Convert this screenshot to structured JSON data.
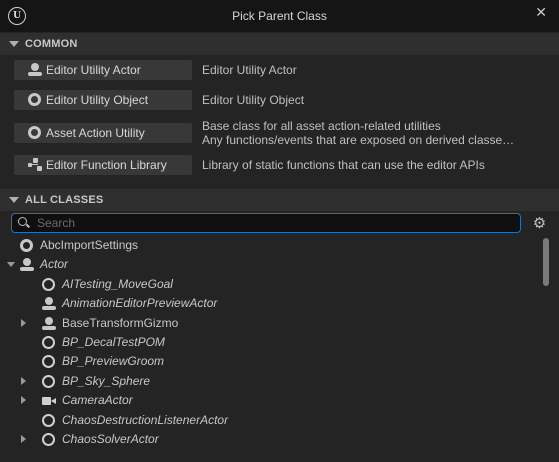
{
  "window": {
    "title": "Pick Parent Class",
    "close_glyph": "✕",
    "logo_letter": "U"
  },
  "common": {
    "header": "COMMON",
    "items": [
      {
        "label": "Editor Utility Actor",
        "icon": "actor-icon",
        "desc": [
          "Editor Utility Actor"
        ]
      },
      {
        "label": "Editor Utility Object",
        "icon": "object-icon",
        "desc": [
          "Editor Utility Object"
        ]
      },
      {
        "label": "Asset Action Utility",
        "icon": "object-icon",
        "desc": [
          "Base class for all asset action-related utilities",
          "Any functions/events that are exposed on derived classe…"
        ]
      },
      {
        "label": "Editor Function Library",
        "icon": "function-library-icon",
        "desc": [
          "Library of static functions that can use the editor APIs"
        ]
      }
    ]
  },
  "all_classes": {
    "header": "ALL CLASSES",
    "search_placeholder": "Search",
    "settings_glyph": "⚙",
    "items": [
      {
        "label": "AbcImportSettings",
        "icon": "object-icon",
        "italic": false,
        "level": 0,
        "expander": "none"
      },
      {
        "label": "Actor",
        "icon": "actor-icon",
        "italic": true,
        "level": 0,
        "expander": "down"
      },
      {
        "label": "AITesting_MoveGoal",
        "icon": "ring-icon",
        "italic": true,
        "level": 1,
        "expander": "none"
      },
      {
        "label": "AnimationEditorPreviewActor",
        "icon": "actor-icon",
        "italic": true,
        "level": 1,
        "expander": "none"
      },
      {
        "label": "BaseTransformGizmo",
        "icon": "actor-icon",
        "italic": false,
        "level": 1,
        "expander": "right"
      },
      {
        "label": "BP_DecalTestPOM",
        "icon": "ring-icon",
        "italic": true,
        "level": 1,
        "expander": "none"
      },
      {
        "label": "BP_PreviewGroom",
        "icon": "ring-icon",
        "italic": true,
        "level": 1,
        "expander": "none"
      },
      {
        "label": "BP_Sky_Sphere",
        "icon": "ring-icon",
        "italic": true,
        "level": 1,
        "expander": "right"
      },
      {
        "label": "CameraActor",
        "icon": "camera-icon",
        "italic": true,
        "level": 1,
        "expander": "right"
      },
      {
        "label": "ChaosDestructionListenerActor",
        "icon": "ring-icon",
        "italic": true,
        "level": 1,
        "expander": "none"
      },
      {
        "label": "ChaosSolverActor",
        "icon": "ring-icon",
        "italic": true,
        "level": 1,
        "expander": "right"
      }
    ],
    "scroll_fraction": 0.0
  }
}
